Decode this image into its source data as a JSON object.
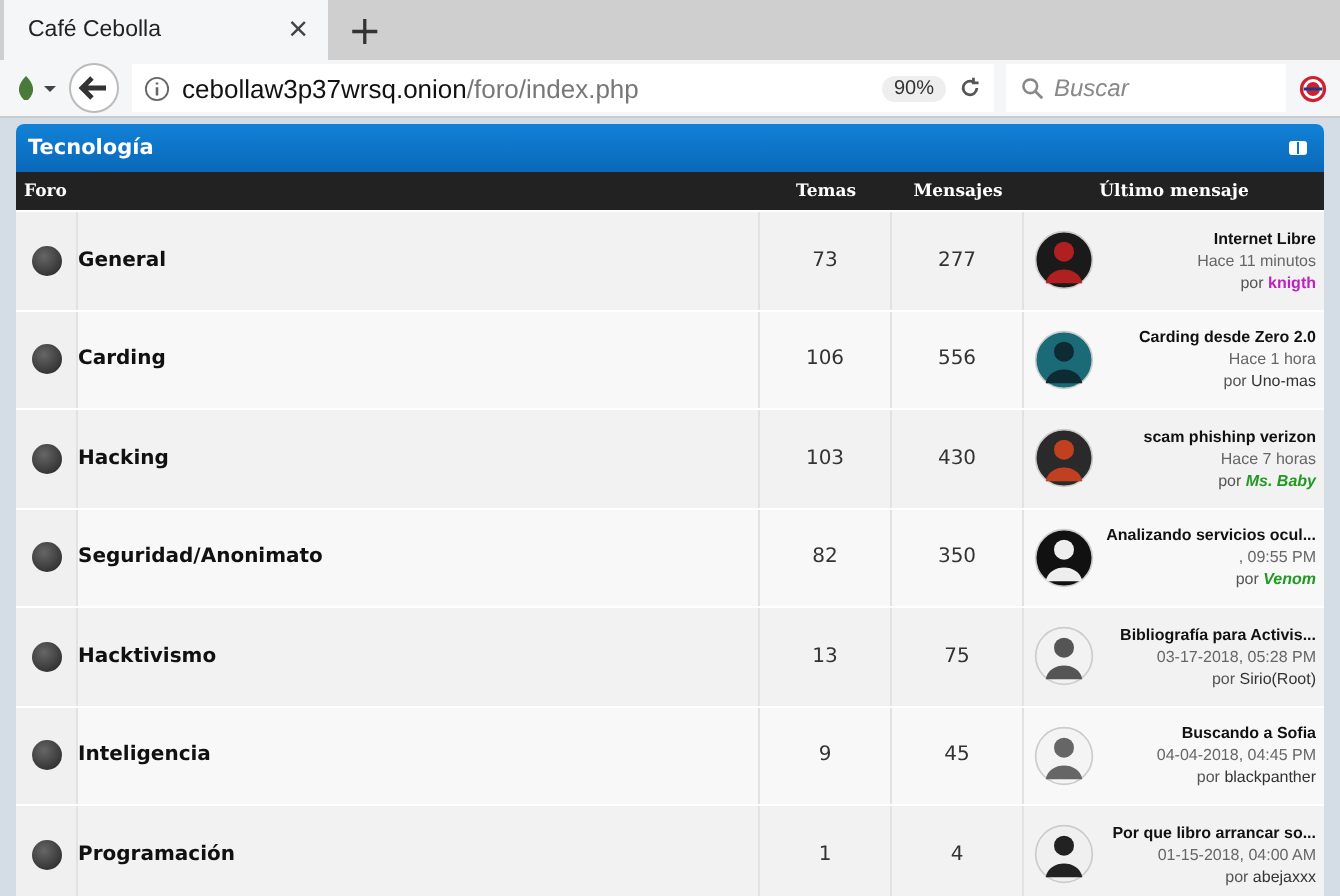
{
  "browser": {
    "tab_title": "Café Cebolla",
    "new_tab": "+",
    "close": "×",
    "url_host": "cebollaw3p37wrsq.onion",
    "url_path": "/foro/index.php",
    "zoom": "90%",
    "search_placeholder": "Buscar"
  },
  "category": {
    "title": "Tecnología"
  },
  "columns": [
    "Foro",
    "Temas",
    "Mensajes",
    "Último mensaje"
  ],
  "forums": [
    {
      "name": "General",
      "topics": "73",
      "posts": "277",
      "last_title": "Internet Libre",
      "last_time": "Hace 11 minutos",
      "by": "por",
      "author": "knigth",
      "kind": "bold",
      "color": "#c020c0"
    },
    {
      "name": "Carding",
      "topics": "106",
      "posts": "556",
      "last_title": "Carding desde Zero 2.0",
      "last_time": "Hace 1 hora",
      "by": "por",
      "author": "Uno-mas",
      "kind": "plain",
      "color": "#333333"
    },
    {
      "name": "Hacking",
      "topics": "103",
      "posts": "430",
      "last_title": "scam phishinp verizon",
      "last_time": "Hace 7 horas",
      "by": "por",
      "author": "Ms. Baby",
      "kind": "bold-italic",
      "color": "#229922"
    },
    {
      "name": "Seguridad/Anonimato",
      "topics": "82",
      "posts": "350",
      "last_title": "Analizando servicios ocul...",
      "last_time": ", 09:55 PM",
      "by": "por",
      "author": "Venom",
      "kind": "bold-italic",
      "color": "#229922"
    },
    {
      "name": "Hacktivismo",
      "topics": "13",
      "posts": "75",
      "last_title": "Bibliografía para Activis...",
      "last_time": "03-17-2018, 05:28 PM",
      "by": "por",
      "author": "Sirio(Root)",
      "kind": "plain",
      "color": "#333333"
    },
    {
      "name": "Inteligencia",
      "topics": "9",
      "posts": "45",
      "last_title": "Buscando a Sofia",
      "last_time": "04-04-2018, 04:45 PM",
      "by": "por",
      "author": "blackpanther",
      "kind": "plain",
      "color": "#333333"
    },
    {
      "name": "Programación",
      "topics": "1",
      "posts": "4",
      "last_title": "Por que libro arrancar so...",
      "last_time": "01-15-2018, 04:00 AM",
      "by": "por",
      "author": "abejaxxx",
      "kind": "plain",
      "color": "#333333"
    }
  ]
}
